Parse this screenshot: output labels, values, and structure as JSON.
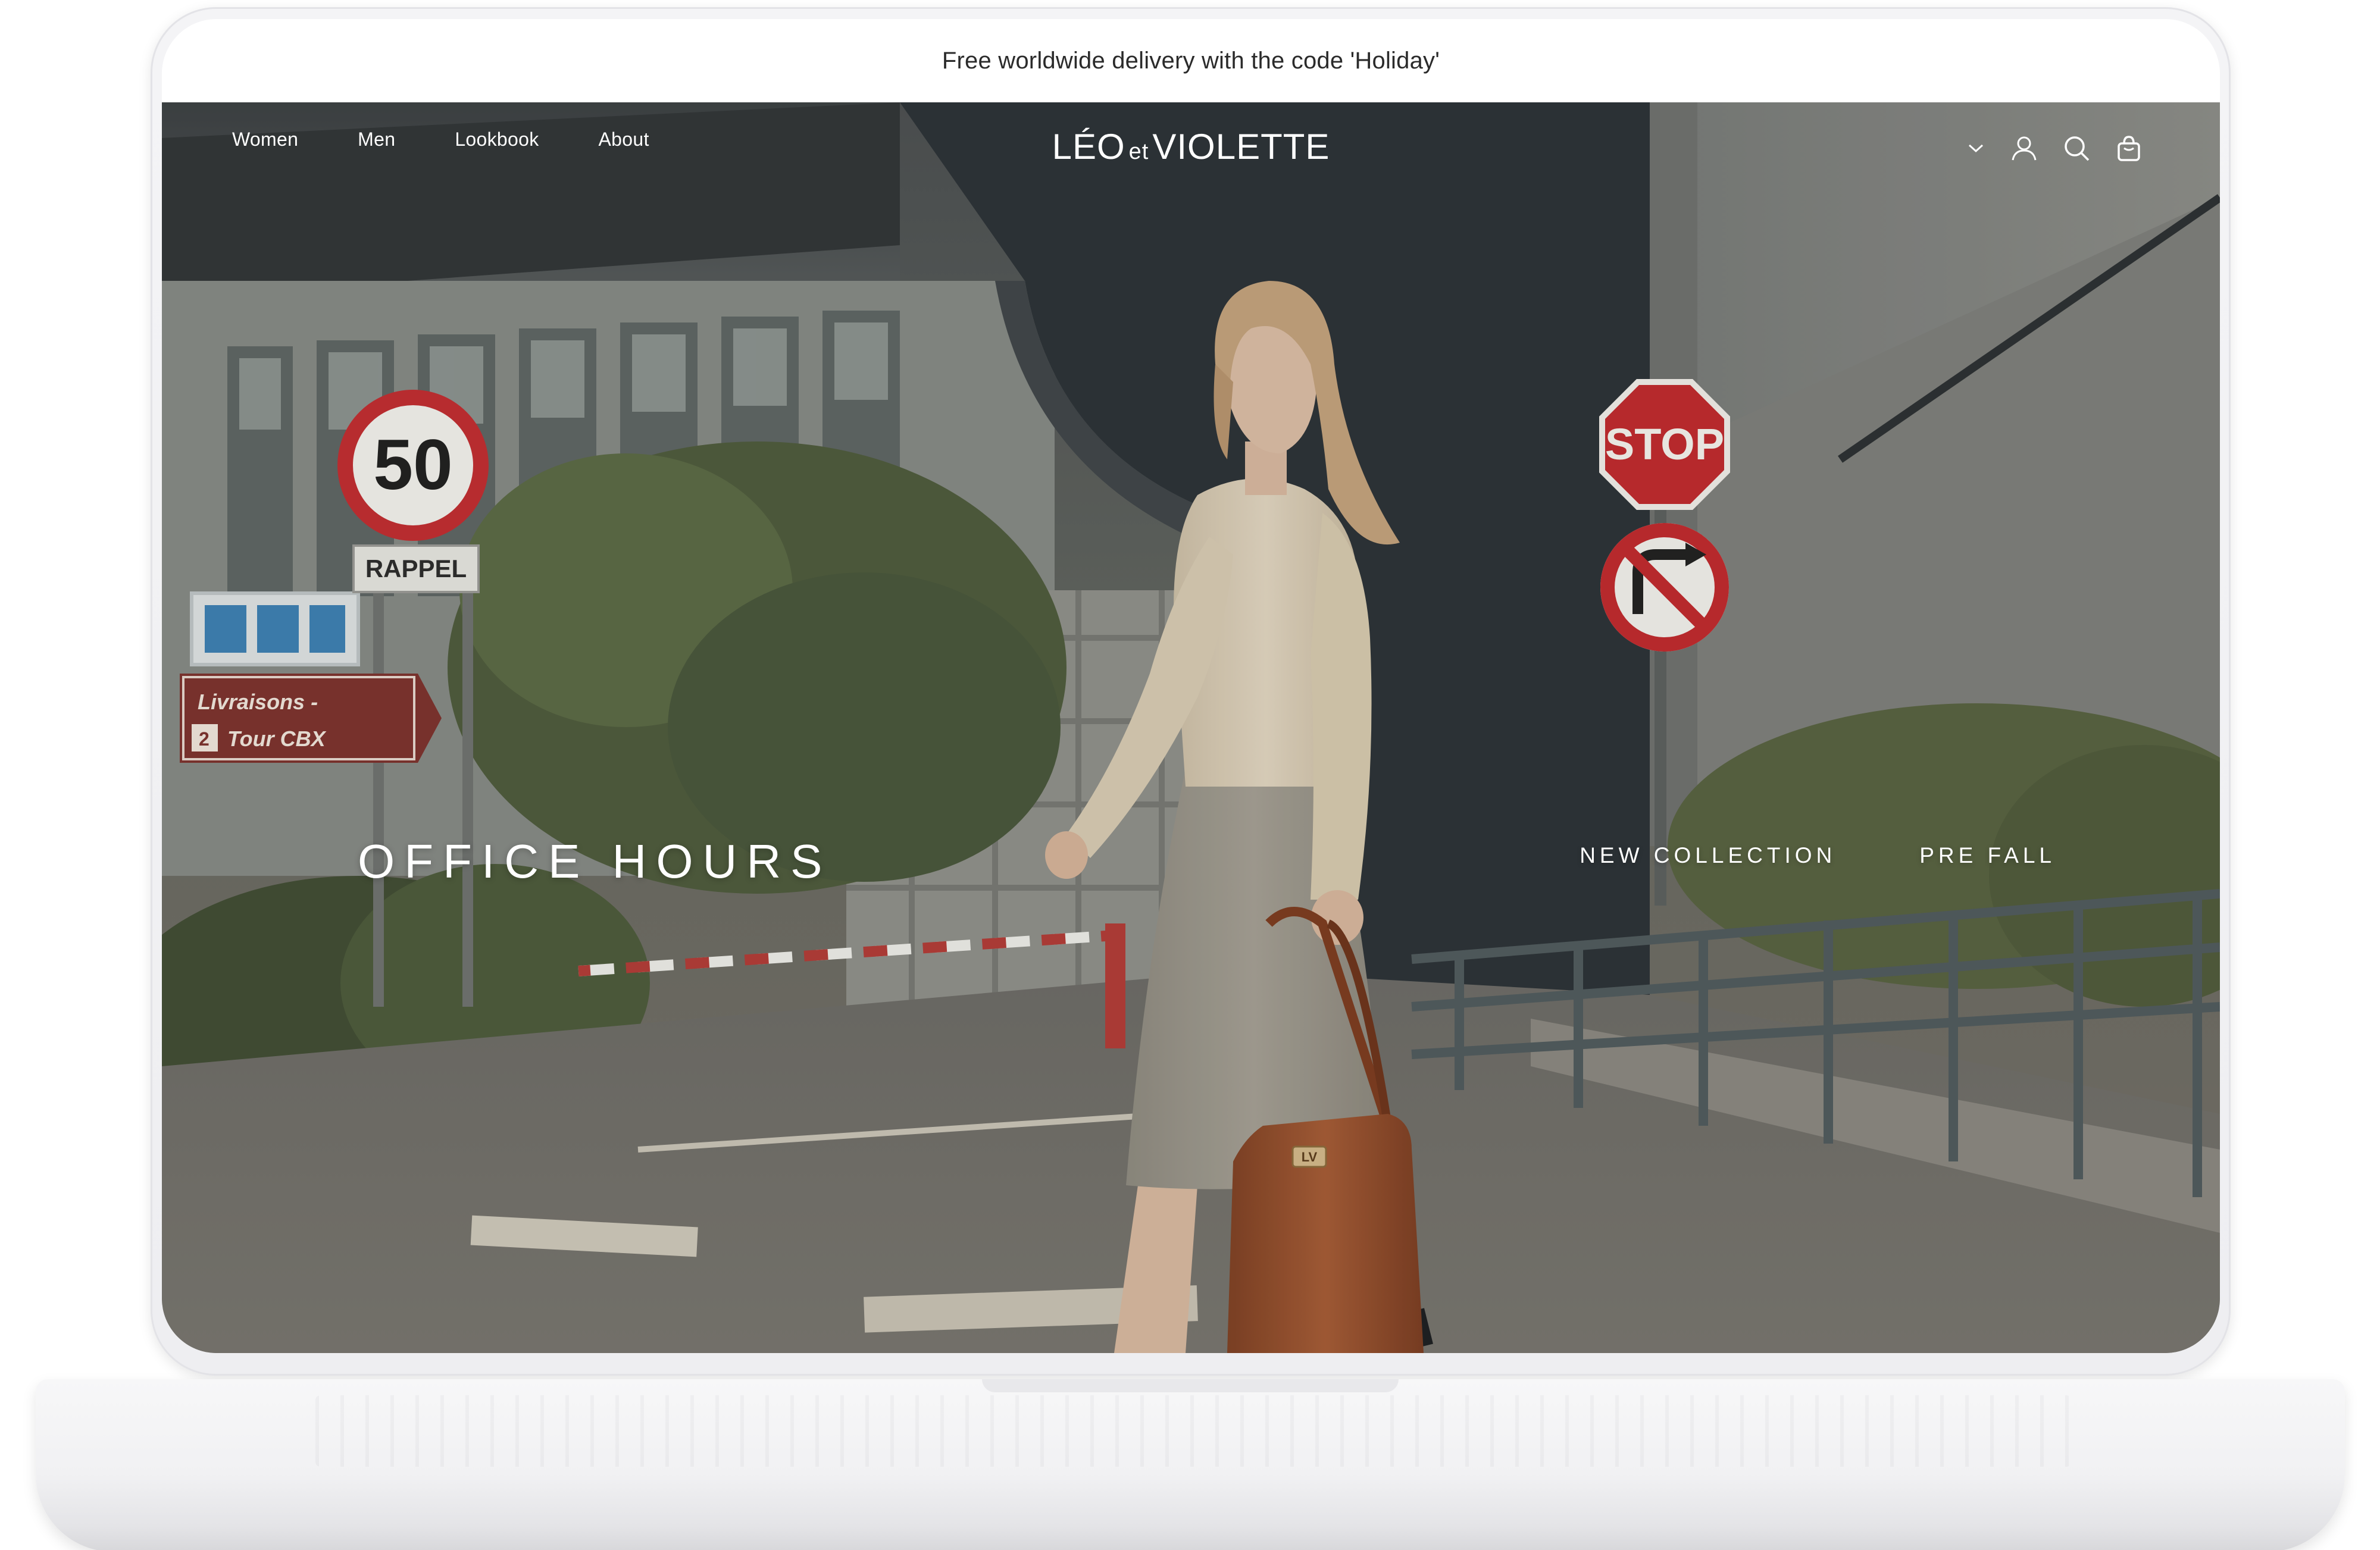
{
  "announcement": {
    "text": "Free worldwide delivery with the code 'Holiday'"
  },
  "nav": {
    "items": [
      {
        "label": "Women"
      },
      {
        "label": "Men"
      },
      {
        "label": "Lookbook"
      },
      {
        "label": "About"
      }
    ]
  },
  "brand": {
    "part1": "LÉO",
    "part2": "et",
    "part3": "VIOLETTE"
  },
  "header_icons": [
    "chevron-down-icon",
    "account-icon",
    "search-icon",
    "cart-icon"
  ],
  "hero": {
    "title": "OFFICE HOURS",
    "links": [
      {
        "label": "NEW COLLECTION"
      },
      {
        "label": "PRE FALL"
      }
    ],
    "signs": {
      "speed_limit": "50",
      "rappel": "RAPPEL",
      "stop": "STOP",
      "livraisons": "Livraisons -",
      "tour": "Tour CBX",
      "tour_number": "2",
      "bag_badge": "LV"
    }
  },
  "colors": {
    "text_on_hero": "#ffffff",
    "announcement_text": "#2b2b2b",
    "stop_red": "#c0282c",
    "bag_brown": "#9a5230"
  }
}
